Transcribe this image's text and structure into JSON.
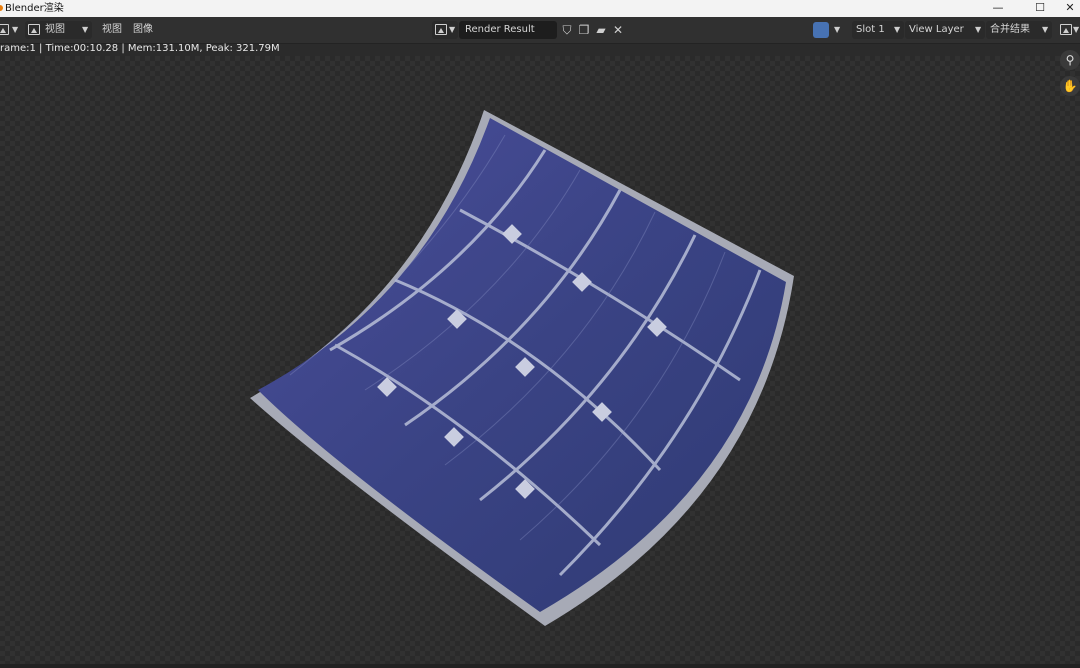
{
  "window": {
    "title": "Blender渲染"
  },
  "window_controls": {
    "minimize": "—",
    "maximize": "☐",
    "close": "✕"
  },
  "header": {
    "view_menu": "视图",
    "image_menu": "图像",
    "image_name": "Render Result",
    "slot": "Slot 1",
    "view_layer": "View Layer",
    "pass": "合并结果"
  },
  "stats": {
    "text": "rame:1 | Time:00:10.28 | Mem:131.10M, Peak: 321.79M"
  },
  "colors": {
    "accent": "#4772b3",
    "panel": "#303030",
    "header_bg": "#303030"
  }
}
